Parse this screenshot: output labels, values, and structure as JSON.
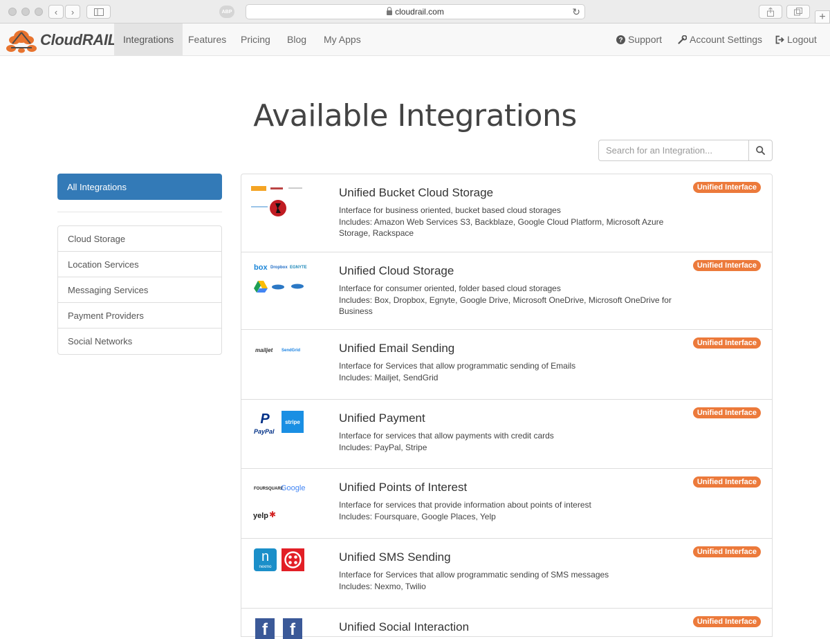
{
  "browser": {
    "url": "cloudrail.com",
    "adblock_label": "ABP"
  },
  "navbar": {
    "brand": "CloudRAIL",
    "items": [
      {
        "label": "Integrations"
      },
      {
        "label": "Features"
      },
      {
        "label": "Pricing"
      },
      {
        "label": "Blog"
      },
      {
        "label": "My Apps"
      }
    ],
    "right": {
      "support": "Support",
      "account": "Account Settings",
      "logout": "Logout"
    }
  },
  "page_title": "Available Integrations",
  "search": {
    "placeholder": "Search for an Integration..."
  },
  "sidebar": {
    "all_label": "All Integrations",
    "categories": [
      {
        "label": "Cloud Storage"
      },
      {
        "label": "Location Services"
      },
      {
        "label": "Messaging Services"
      },
      {
        "label": "Payment Providers"
      },
      {
        "label": "Social Networks"
      }
    ]
  },
  "integrations": [
    {
      "title": "Unified Bucket Cloud Storage",
      "description": "Interface for business oriented, bucket based cloud storages",
      "includes": "Includes: Amazon Web Services S3, Backblaze, Google Cloud Platform, Microsoft Azure Storage, Rackspace",
      "badge": "Unified Interface",
      "logos": [
        "amazon-web-services-logo",
        "backblaze-logo",
        "google-cloud-logo",
        "microsoft-azure-logo",
        "rackspace-logo"
      ]
    },
    {
      "title": "Unified Cloud Storage",
      "description": "Interface for consumer oriented, folder based cloud storages",
      "includes": "Includes: Box, Dropbox, Egnyte, Google Drive, Microsoft OneDrive, Microsoft OneDrive for Business",
      "badge": "Unified Interface",
      "logos": [
        "box-logo",
        "dropbox-logo",
        "egnyte-logo",
        "google-drive-logo",
        "onedrive-logo",
        "onedrive-business-logo"
      ]
    },
    {
      "title": "Unified Email Sending",
      "description": "Interface for Services that allow programmatic sending of Emails",
      "includes": "Includes: Mailjet, SendGrid",
      "badge": "Unified Interface",
      "logos": [
        "mailjet-logo",
        "sendgrid-logo"
      ]
    },
    {
      "title": "Unified Payment",
      "description": "Interface for services that allow payments with credit cards",
      "includes": "Includes: PayPal, Stripe",
      "badge": "Unified Interface",
      "logos": [
        "paypal-logo",
        "stripe-logo"
      ]
    },
    {
      "title": "Unified Points of Interest",
      "description": "Interface for services that provide information about points of interest",
      "includes": "Includes: Foursquare, Google Places, Yelp",
      "badge": "Unified Interface",
      "logos": [
        "foursquare-logo",
        "google-logo",
        "yelp-logo"
      ]
    },
    {
      "title": "Unified SMS Sending",
      "description": "Interface for Services that allow programmatic sending of SMS messages",
      "includes": "Includes: Nexmo, Twilio",
      "badge": "Unified Interface",
      "logos": [
        "nexmo-logo",
        "twilio-logo"
      ]
    },
    {
      "title": "Unified Social Interaction",
      "description": "",
      "includes": "",
      "badge": "Unified Interface",
      "logos": [
        "facebook-logo",
        "facebook-logo"
      ]
    }
  ],
  "logo_text": {
    "box": "box",
    "dropbox": "Dropbox",
    "egnyte": "EGNYTE",
    "mailjet": "mailjet",
    "sendgrid": "SendGrid",
    "paypal": "PayPal",
    "stripe": "stripe",
    "foursquare": "FOURSQUARE",
    "google": "Google",
    "yelp": "yelp",
    "nexmo": "nexmo",
    "facebook": "f"
  },
  "colors": {
    "accent_blue": "#337ab7",
    "badge_orange": "#ec7a3b",
    "brand_orange": "#e8742f"
  }
}
